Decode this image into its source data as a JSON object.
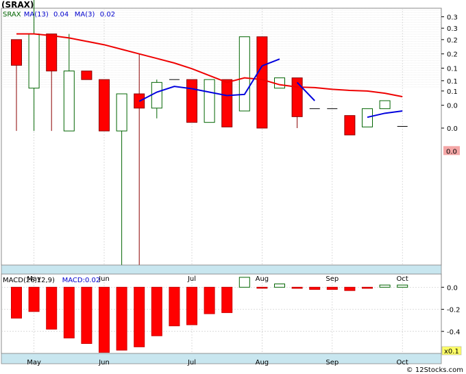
{
  "title": "(SRAX)",
  "watermark": "© 12Stocks.com",
  "colors": {
    "up_candle": "#006400",
    "down_candle": "#ff0000",
    "ma_long": "#ee0000",
    "ma_short": "#0000dd",
    "macd_bar": "#ff0000",
    "axis_band": "#c8e6ef",
    "badge": "#f4a6a6",
    "badge_macd": "#ffff66",
    "legend_text": "#0000cc",
    "legend_ticker": "#006400"
  },
  "chart_data": [
    {
      "type": "candlestick",
      "legend": [
        {
          "label": "SRAX",
          "color_key": "legend_ticker"
        },
        {
          "label": "MA(13)",
          "color_key": "legend_text"
        },
        {
          "label": "0.04",
          "color_key": "legend_text"
        },
        {
          "label": "MA(3)",
          "color_key": "legend_text"
        },
        {
          "label": "0.02",
          "color_key": "legend_text"
        }
      ],
      "months": [
        "May",
        "Jun",
        "Jul",
        "Aug",
        "Sep",
        "Oct"
      ],
      "month_week_index": [
        1,
        5,
        10,
        14,
        18,
        22
      ],
      "y_ticks": [
        "0.3",
        "0.3",
        "0.2",
        "0.2",
        "0.1",
        "0.1",
        "0.1",
        "0.0",
        "0.0"
      ],
      "y_tick_values": [
        0.275,
        0.255,
        0.235,
        0.21,
        0.185,
        0.163,
        0.145,
        0.12,
        0.08
      ],
      "last_badge": "0.0",
      "last_value": 0.04,
      "ylim": [
        -0.16,
        0.29
      ],
      "weeks": [
        {
          "open": 0.235,
          "close": 0.19,
          "high": 0.235,
          "low": 0.075,
          "dir": "down"
        },
        {
          "open": 0.15,
          "close": 0.245,
          "high": 0.305,
          "low": 0.075,
          "dir": "up"
        },
        {
          "open": 0.245,
          "close": 0.18,
          "high": 0.245,
          "low": 0.075,
          "dir": "down"
        },
        {
          "open": 0.075,
          "close": 0.18,
          "high": 0.245,
          "low": 0.075,
          "dir": "up"
        },
        {
          "open": 0.18,
          "close": 0.165,
          "high": 0.18,
          "low": 0.165,
          "dir": "down"
        },
        {
          "open": 0.165,
          "close": 0.075,
          "high": 0.165,
          "low": 0.075,
          "dir": "down"
        },
        {
          "open": 0.075,
          "close": 0.14,
          "high": 0.14,
          "low": -0.16,
          "dir": "up"
        },
        {
          "open": 0.14,
          "close": 0.115,
          "high": 0.21,
          "low": -0.16,
          "dir": "down"
        },
        {
          "open": 0.115,
          "close": 0.16,
          "high": 0.165,
          "low": 0.097,
          "dir": "up"
        },
        {
          "open": 0.165,
          "close": 0.165,
          "high": 0.165,
          "low": 0.165,
          "dir": "down"
        },
        {
          "open": 0.165,
          "close": 0.09,
          "high": 0.165,
          "low": 0.09,
          "dir": "down"
        },
        {
          "open": 0.09,
          "close": 0.165,
          "high": 0.165,
          "low": 0.09,
          "dir": "up"
        },
        {
          "open": 0.165,
          "close": 0.082,
          "high": 0.165,
          "low": 0.082,
          "dir": "down"
        },
        {
          "open": 0.11,
          "close": 0.24,
          "high": 0.24,
          "low": 0.11,
          "dir": "up"
        },
        {
          "open": 0.24,
          "close": 0.08,
          "high": 0.24,
          "low": 0.08,
          "dir": "down"
        },
        {
          "open": 0.15,
          "close": 0.168,
          "high": 0.168,
          "low": 0.15,
          "dir": "up"
        },
        {
          "open": 0.168,
          "close": 0.1,
          "high": 0.168,
          "low": 0.08,
          "dir": "down"
        },
        {
          "open": 0.114,
          "close": 0.114,
          "high": 0.114,
          "low": 0.114,
          "dir": "down"
        },
        {
          "open": 0.114,
          "close": 0.114,
          "high": 0.114,
          "low": 0.114,
          "dir": "down"
        },
        {
          "open": 0.102,
          "close": 0.068,
          "high": 0.102,
          "low": 0.068,
          "dir": "down"
        },
        {
          "open": 0.082,
          "close": 0.114,
          "high": 0.114,
          "low": 0.082,
          "dir": "up"
        },
        {
          "open": 0.114,
          "close": 0.128,
          "high": 0.128,
          "low": 0.114,
          "dir": "up"
        },
        {
          "open": 0.083,
          "close": 0.083,
          "high": 0.083,
          "low": 0.083,
          "dir": "down"
        }
      ],
      "ma13": [
        0.245,
        0.245,
        0.242,
        0.238,
        0.232,
        0.226,
        0.218,
        0.21,
        0.202,
        0.194,
        0.184,
        0.172,
        0.16,
        0.168,
        0.165,
        0.156,
        0.152,
        0.151,
        0.148,
        0.146,
        0.145,
        0.141,
        0.135
      ],
      "ma3": [
        null,
        null,
        null,
        null,
        null,
        null,
        null,
        0.127,
        0.143,
        0.153,
        0.149,
        0.143,
        0.137,
        0.139,
        0.189,
        0.201,
        0.16,
        0.128,
        0.107,
        0.098,
        0.099,
        0.106,
        0.11
      ],
      "ma3_segments": [
        [
          7,
          12
        ],
        [
          12,
          14
        ],
        [
          14,
          15
        ],
        [
          16,
          17
        ],
        [
          20,
          22
        ]
      ]
    },
    {
      "type": "bar",
      "legend": [
        {
          "label": "MACD(26,12,9)",
          "color_key": "legend_text_black"
        },
        {
          "label": "MACD:0.02",
          "color_key": "legend_text"
        }
      ],
      "y_ticks": [
        "0.0",
        "-0.2",
        "-0.4"
      ],
      "y_tick_values": [
        0.0,
        -0.2,
        -0.4
      ],
      "ylim": [
        -0.6,
        0.12
      ],
      "last_badge": "x0.1",
      "values": [
        -0.28,
        -0.22,
        -0.38,
        -0.46,
        -0.51,
        -0.59,
        -0.57,
        -0.54,
        -0.44,
        -0.35,
        -0.34,
        -0.24,
        -0.23,
        0.09,
        0.0,
        0.03,
        -0.01,
        -0.02,
        -0.02,
        -0.03,
        -0.01,
        0.02,
        0.02
      ],
      "hollow_indices": [
        13,
        15,
        21,
        22
      ]
    }
  ]
}
